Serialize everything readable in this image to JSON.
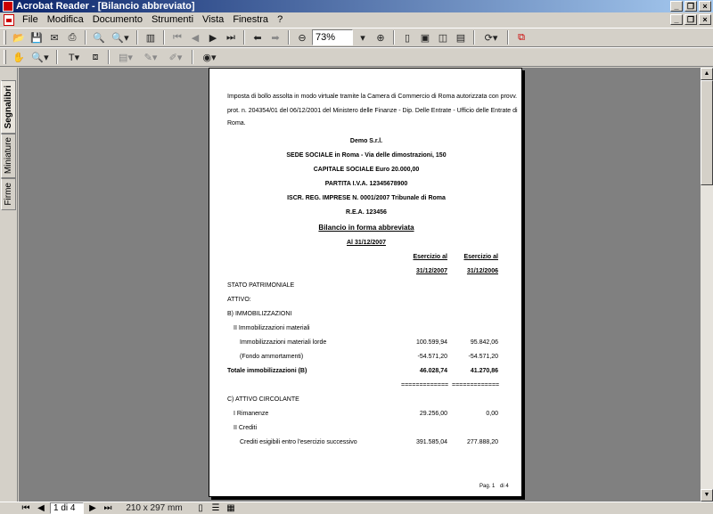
{
  "window": {
    "title": "Acrobat Reader - [Bilancio abbreviato]"
  },
  "menu": {
    "items": [
      "File",
      "Modifica",
      "Documento",
      "Strumenti",
      "Vista",
      "Finestra",
      "?"
    ]
  },
  "toolbar": {
    "zoom_value": "73%"
  },
  "nav_tabs": [
    "Segnalibri",
    "Miniature",
    "Firme"
  ],
  "document": {
    "intro_lines": [
      "Imposta di bollo assolta in modo virtuale tramite la Camera di Commercio di Roma autorizzata con provv.",
      "prot. n. 204354/01 del 06/12/2001 del Ministero delle Finanze - Dip. Delle Entrate - Ufficio delle Entrate di",
      "Roma."
    ],
    "company": "Demo S.r.l.",
    "sede": "SEDE SOCIALE in Roma - Via delle dimostrazioni, 150",
    "capitale": "CAPITALE SOCIALE Euro 20.000,00",
    "piva": "PARTITA I.V.A. 12345678900",
    "iscr": "ISCR. REG. IMPRESE N. 0001/2007 Tribunale di Roma",
    "rea": "R.E.A. 123456",
    "heading": "Bilancio in forma abbreviata",
    "date": "Al 31/12/2007",
    "col1_header": [
      "Esercizio al",
      "31/12/2007"
    ],
    "col2_header": [
      "Esercizio al",
      "31/12/2006"
    ],
    "stato": "STATO PATRIMONIALE",
    "attivo": "ATTIVO:",
    "immob": "B) IMMOBILIZZAZIONI",
    "immob_mat": "II Immobilizzazioni materiali",
    "rows": [
      {
        "label": "Immobilizzazioni materiali lorde",
        "v1": "100.599,94",
        "v2": "95.842,06"
      },
      {
        "label": "(Fondo ammortamenti)",
        "v1": "-54.571,20",
        "v2": "-54.571,20"
      },
      {
        "label": "Totale immobilizzazioni (B)",
        "v1": "46.028,74",
        "v2": "41.270,86"
      }
    ],
    "equals": "=============",
    "circolante": "C) ATTIVO CIRCOLANTE",
    "rimanenze": {
      "label": "I Rimanenze",
      "v1": "29.256,00",
      "v2": "0,00"
    },
    "crediti": "II Crediti",
    "crediti_row": {
      "label": "Crediti esigibili entro l'esercizio successivo",
      "v1": "391.585,04",
      "v2": "277.888,20"
    },
    "footer_pag": "Pag. 1",
    "footer_di": "di 4"
  },
  "status": {
    "page": "1 di 4",
    "page_size": "210 x 297 mm"
  }
}
